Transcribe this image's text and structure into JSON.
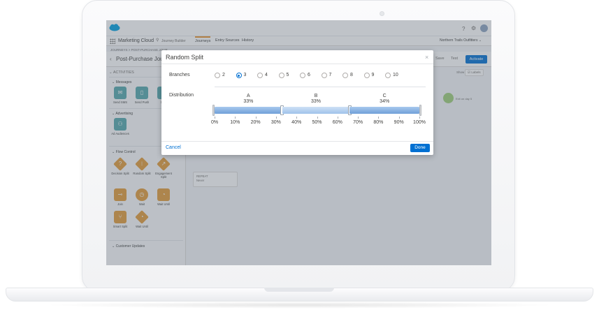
{
  "topbar": {
    "help_icon": "help-icon",
    "settings_icon": "gear-icon"
  },
  "nav": {
    "app_name": "Marketing Cloud",
    "sub_label": "Journey Builder",
    "tabs": [
      {
        "label": "Journeys",
        "active": true
      },
      {
        "label": "Entry Sources",
        "active": false
      },
      {
        "label": "History",
        "active": false
      }
    ],
    "org": "Northern Trails Outfitters"
  },
  "breadcrumb": "JOURNEYS > POST-PURCHASE JOUR...",
  "page": {
    "title": "Post-Purchase Journ...",
    "save_label": "Save",
    "test_label": "Test",
    "activate_label": "Activate"
  },
  "sidebar": {
    "header": "ACTIVITIES",
    "sections": {
      "messages": "Messages",
      "advertising": "Advertising",
      "flow_control": "Flow Control",
      "customer_updates": "Customer Updates"
    },
    "messages": [
      {
        "label": "Send SMS",
        "icon": "sms-icon"
      },
      {
        "label": "Send Push",
        "icon": "push-icon"
      },
      {
        "label": "Se...",
        "icon": "email-icon"
      }
    ],
    "advertising": [
      {
        "label": "Ad Audiences",
        "icon": "audience-icon"
      }
    ],
    "flow_control": [
      {
        "label": "Decision Split",
        "icon": "question-icon"
      },
      {
        "label": "Random Split",
        "icon": "split-icon"
      },
      {
        "label": "Engagement Split",
        "icon": "engagement-icon"
      },
      {
        "label": "Join",
        "icon": "join-icon"
      },
      {
        "label": "Wait",
        "icon": "clock-icon"
      },
      {
        "label": "Wait Until",
        "icon": "wait-until-icon"
      },
      {
        "label": "Smart Split",
        "icon": "smart-split-icon"
      },
      {
        "label": "Wait Until",
        "icon": "wait-until-icon"
      }
    ]
  },
  "canvas": {
    "show_label": "Show",
    "labels_chip": "Labels",
    "exit_label": "Exit on day 5",
    "repeat_title": "REPEAT",
    "repeat_value": "Never"
  },
  "modal": {
    "title": "Random Split",
    "close_icon": "close-icon",
    "branches_label": "Branches",
    "branch_options": [
      "2",
      "3",
      "4",
      "5",
      "6",
      "7",
      "8",
      "9",
      "10"
    ],
    "selected_branches": "3",
    "distribution_label": "Distribution",
    "distribution": [
      {
        "name": "A",
        "percent_label": "33%",
        "percent": 33
      },
      {
        "name": "B",
        "percent_label": "33%",
        "percent": 33
      },
      {
        "name": "C",
        "percent_label": "34%",
        "percent": 34
      }
    ],
    "scale_ticks": [
      "0%",
      "10%",
      "20%",
      "30%",
      "40%",
      "50%",
      "60%",
      "70%",
      "80%",
      "90%",
      "100%"
    ],
    "cancel_label": "Cancel",
    "done_label": "Done"
  },
  "colors": {
    "brand_blue": "#0070d2",
    "flow_orange": "#e29b39",
    "message_teal": "#54a8ad",
    "tab_accent": "#e8912d"
  }
}
